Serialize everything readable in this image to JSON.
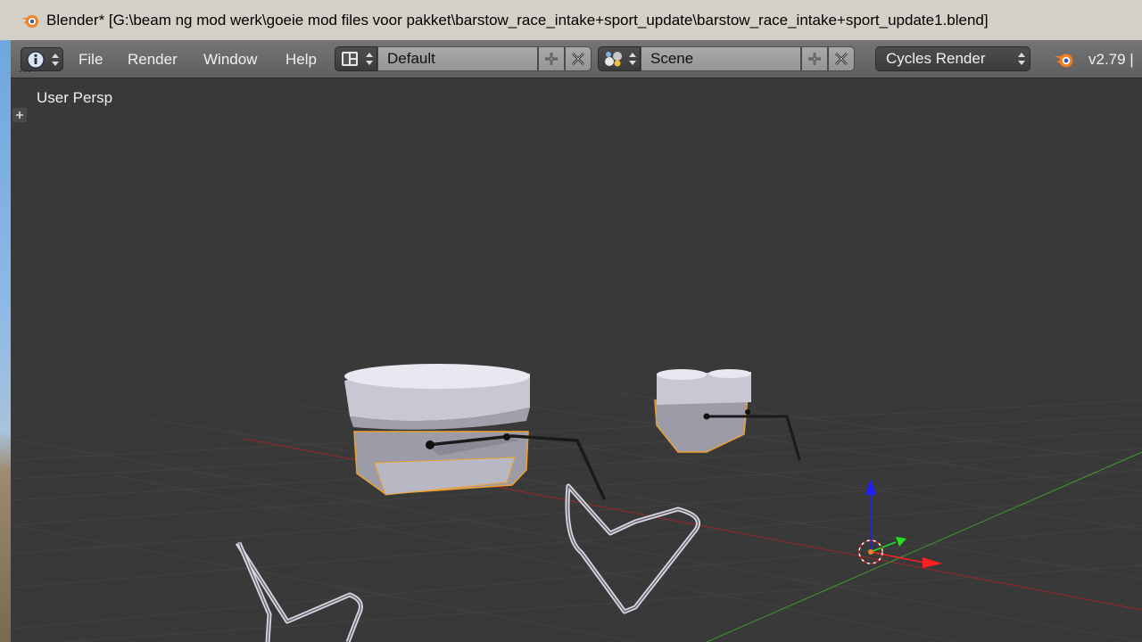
{
  "window": {
    "title": "Blender* [G:\\beam ng mod werk\\goeie mod files voor pakket\\barstow_race_intake+sport_update\\barstow_race_intake+sport_update1.blend]"
  },
  "header": {
    "editor_icon": "info-icon",
    "menus": [
      "File",
      "Render",
      "Window",
      "Help"
    ],
    "screen_layout": "Default",
    "scene": "Scene",
    "render_engine": "Cycles Render",
    "version": "v2.79 |"
  },
  "viewport": {
    "view_label": "User Persp",
    "tool_toggle_icon": "plus-icon"
  },
  "colors": {
    "accent_orange": "#f08020",
    "selection_outline": "#f0a030",
    "x_axis": "#ff2020",
    "y_axis": "#20e020",
    "z_axis": "#2020ff",
    "viewport_bg": "#393939"
  }
}
